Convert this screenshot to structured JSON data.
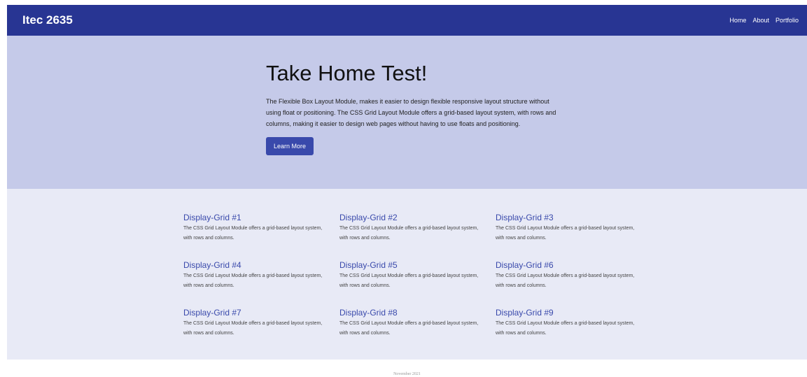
{
  "navbar": {
    "brand": "Itec 2635",
    "links": [
      "Home",
      "About",
      "Portfolio"
    ]
  },
  "hero": {
    "title": "Take Home Test!",
    "text": "The Flexible Box Layout Module, makes it easier to design flexible responsive layout structure without using float or positioning. The CSS Grid Layout Module offers a grid-based layout system, with rows and columns, making it easier to design web pages without having to use floats and positioning.",
    "button_label": "Learn More"
  },
  "grid": {
    "items": [
      {
        "title": "Display-Grid #1",
        "text": "The CSS Grid Layout Module offers a grid-based layout system, with rows and columns."
      },
      {
        "title": "Display-Grid #2",
        "text": "The CSS Grid Layout Module offers a grid-based layout system, with rows and columns."
      },
      {
        "title": "Display-Grid #3",
        "text": "The CSS Grid Layout Module offers a grid-based layout system, with rows and columns."
      },
      {
        "title": "Display-Grid #4",
        "text": "The CSS Grid Layout Module offers a grid-based layout system, with rows and columns."
      },
      {
        "title": "Display-Grid #5",
        "text": "The CSS Grid Layout Module offers a grid-based layout system, with rows and columns."
      },
      {
        "title": "Display-Grid #6",
        "text": "The CSS Grid Layout Module offers a grid-based layout system, with rows and columns."
      },
      {
        "title": "Display-Grid #7",
        "text": "The CSS Grid Layout Module offers a grid-based layout system, with rows and columns."
      },
      {
        "title": "Display-Grid #8",
        "text": "The CSS Grid Layout Module offers a grid-based layout system, with rows and columns."
      },
      {
        "title": "Display-Grid #9",
        "text": "The CSS Grid Layout Module offers a grid-based layout system, with rows and columns."
      }
    ]
  },
  "footer": {
    "text": "November 2021"
  },
  "colors": {
    "navbar": "#283593",
    "hero_bg": "#c5cae9",
    "grid_bg": "#e8eaf6",
    "accent": "#3949ab"
  }
}
